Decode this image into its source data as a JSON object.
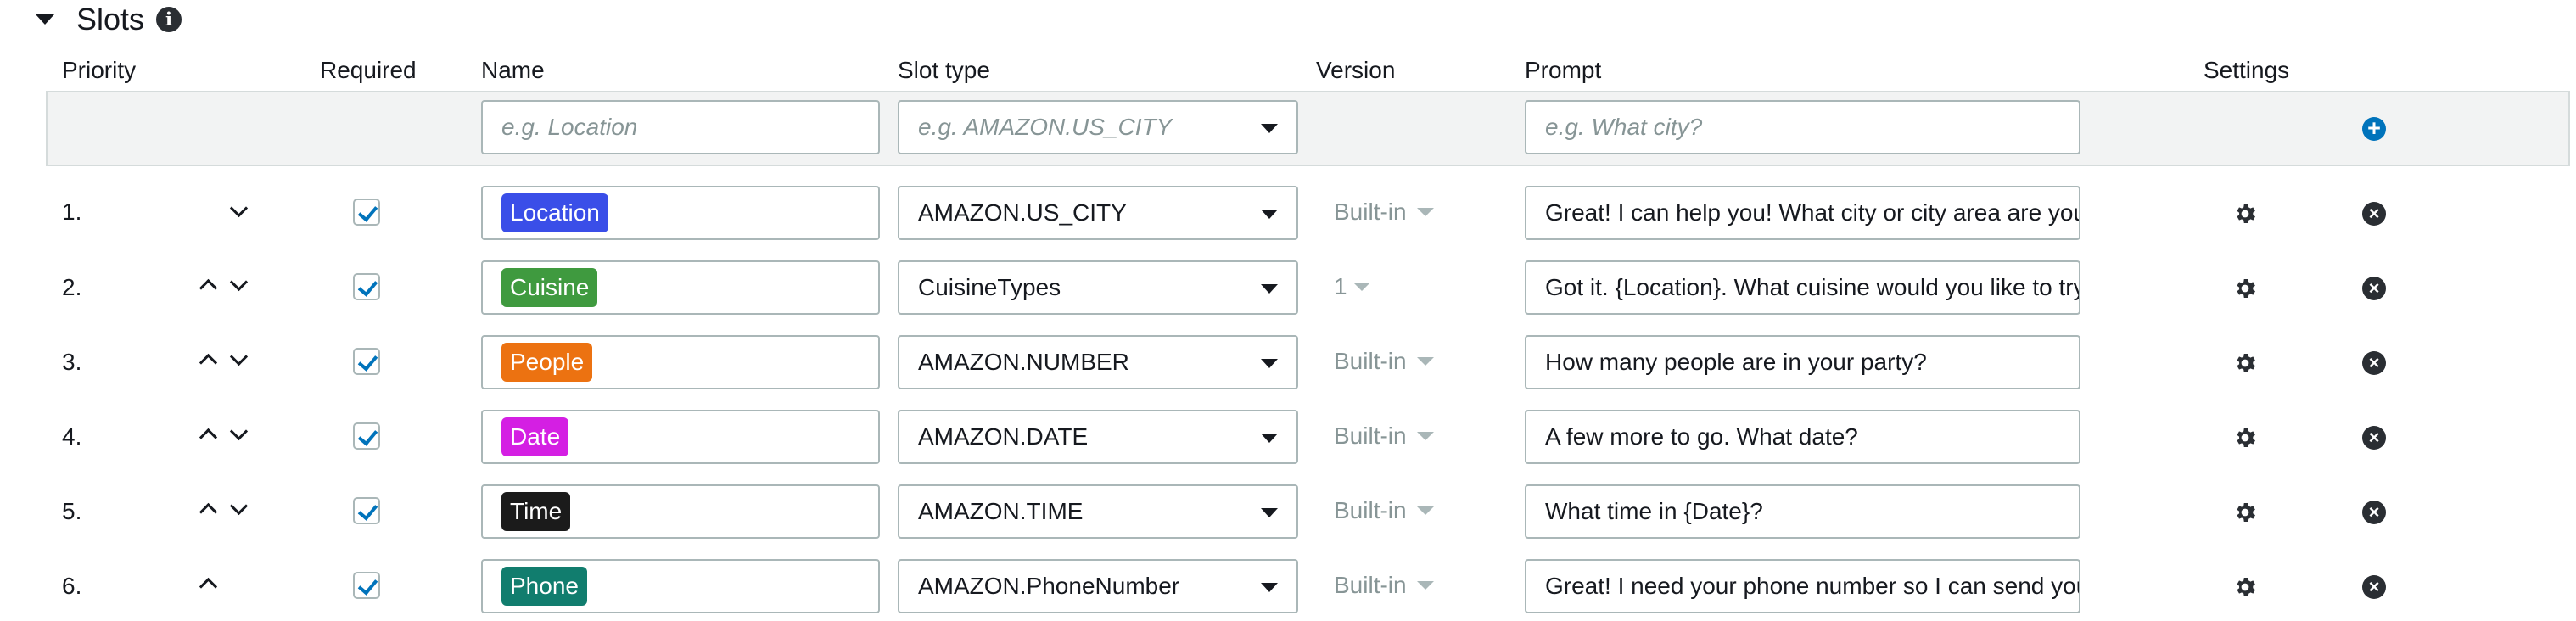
{
  "section": {
    "title": "Slots",
    "info_icon": "i"
  },
  "columns": {
    "priority": "Priority",
    "required": "Required",
    "name": "Name",
    "slot_type": "Slot type",
    "version": "Version",
    "prompt": "Prompt",
    "settings": "Settings"
  },
  "new_slot": {
    "name_placeholder": "e.g. Location",
    "slot_type_placeholder": "e.g. AMAZON.US_CITY",
    "prompt_placeholder": "e.g. What city?"
  },
  "slots": [
    {
      "priority": "1.",
      "name": "Location",
      "tag_color": "#3a4ee8",
      "slot_type": "AMAZON.US_CITY",
      "version": "Built-in",
      "prompt": "Great! I can help you! What city or city area are you",
      "required": true
    },
    {
      "priority": "2.",
      "name": "Cuisine",
      "tag_color": "#3f9a3f",
      "slot_type": "CuisineTypes",
      "version": "1",
      "prompt": "Got it. {Location}. What cuisine would you like to try",
      "required": true
    },
    {
      "priority": "3.",
      "name": "People",
      "tag_color": "#ec7211",
      "slot_type": "AMAZON.NUMBER",
      "version": "Built-in",
      "prompt": "How many people are in your party?",
      "required": true
    },
    {
      "priority": "4.",
      "name": "Date",
      "tag_color": "#d41fe3",
      "slot_type": "AMAZON.DATE",
      "version": "Built-in",
      "prompt": "A few more to go. What date?",
      "required": true
    },
    {
      "priority": "5.",
      "name": "Time",
      "tag_color": "#1b1b1b",
      "slot_type": "AMAZON.TIME",
      "version": "Built-in",
      "prompt": "What time in {Date}?",
      "required": true
    },
    {
      "priority": "6.",
      "name": "Phone",
      "tag_color": "#117d6e",
      "slot_type": "AMAZON.PhoneNumber",
      "version": "Built-in",
      "prompt": "Great! I need your phone number so I can send you",
      "required": true
    }
  ]
}
